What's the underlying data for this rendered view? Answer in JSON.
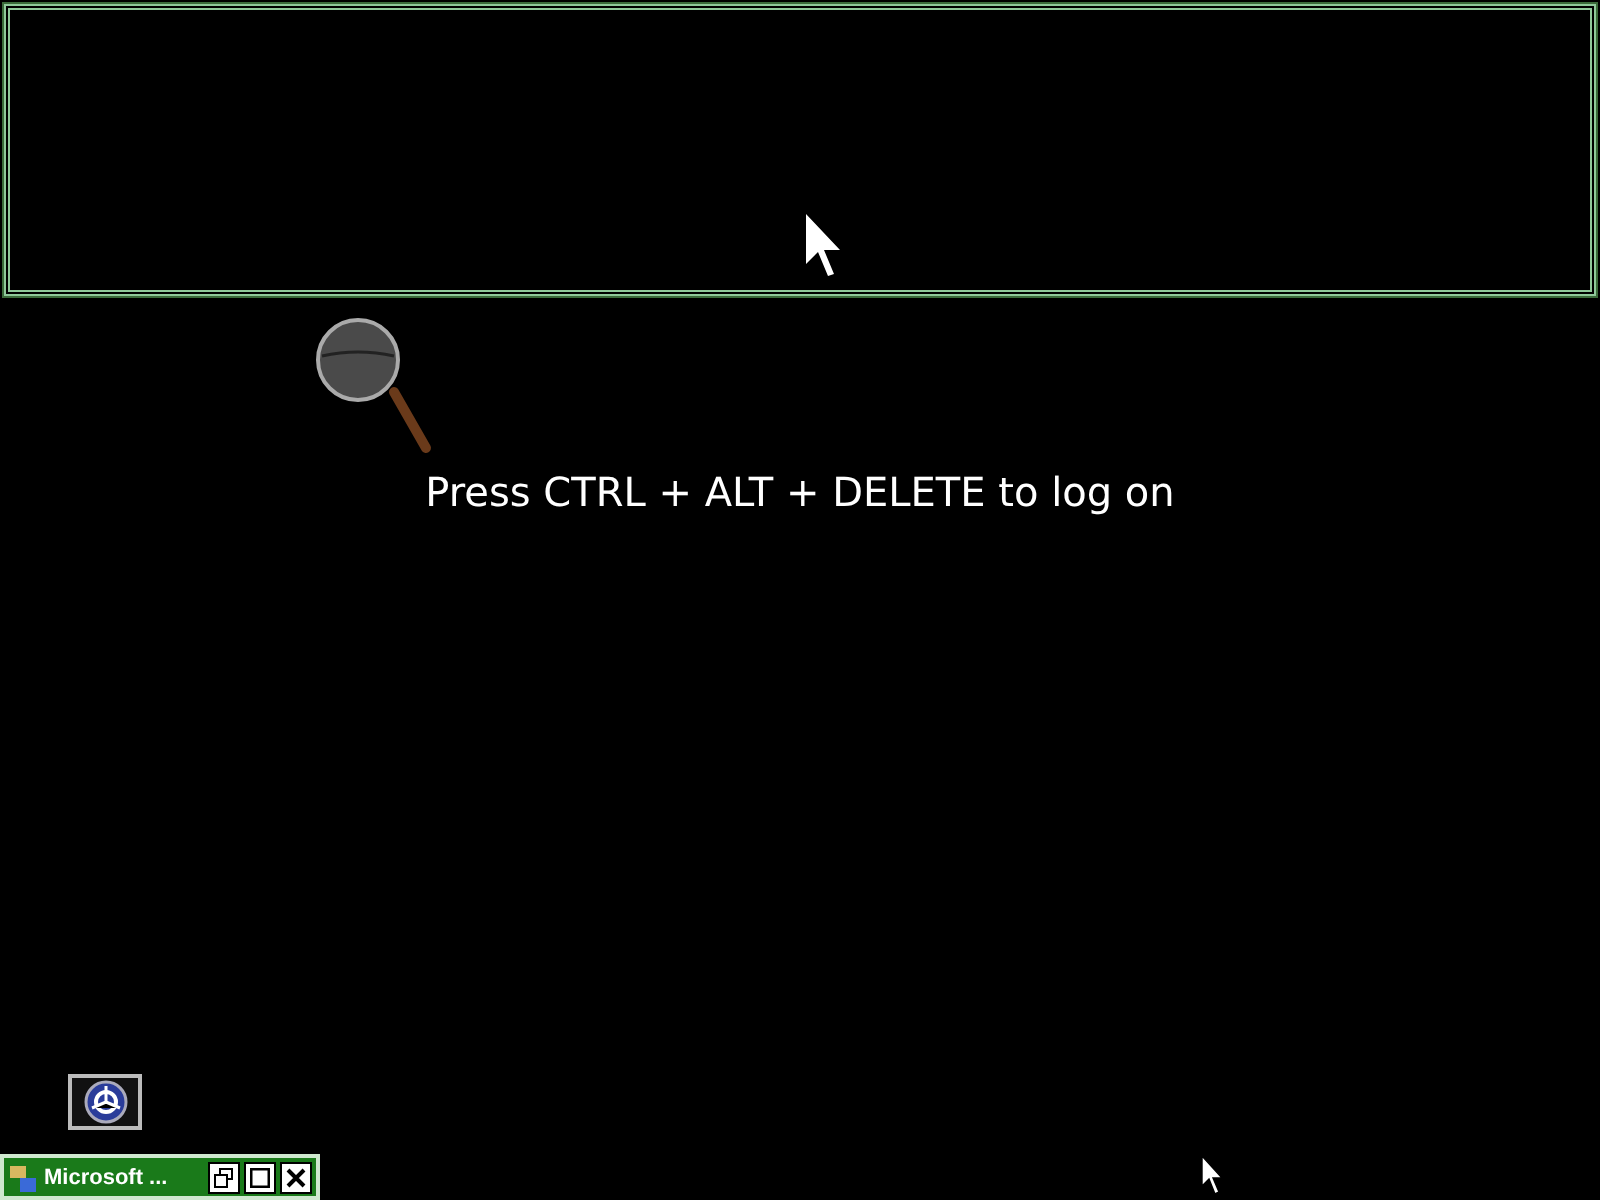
{
  "prompt": "Press CTRL + ALT + DELETE to log on",
  "minimized_window": {
    "title": "Microsoft ..."
  }
}
